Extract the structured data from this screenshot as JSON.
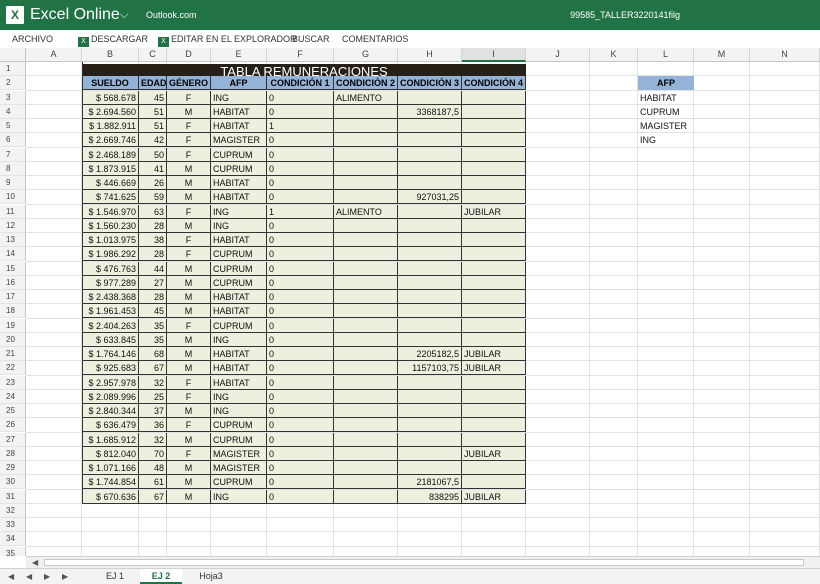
{
  "app": {
    "logo": "X",
    "name": "Excel Online",
    "service": "Outlook.com",
    "document_name": "99585_TALLER3220141filg"
  },
  "ribbon": {
    "archivo": "ARCHIVO",
    "descargar": "DESCARGAR",
    "editar": "EDITAR EN EL EXPLORADOR",
    "buscar": "BUSCAR",
    "comentarios": "COMENTARIOS"
  },
  "columns": [
    "A",
    "B",
    "C",
    "D",
    "E",
    "F",
    "G",
    "H",
    "I",
    "J",
    "K",
    "L",
    "M",
    "N"
  ],
  "selected_column": "I",
  "row_numbers": [
    "1",
    "2",
    "3",
    "4",
    "5",
    "6",
    "7",
    "8",
    "9",
    "10",
    "11",
    "12",
    "13",
    "14",
    "15",
    "16",
    "17",
    "18",
    "19",
    "20",
    "21",
    "22",
    "23",
    "24",
    "25",
    "26",
    "27",
    "28",
    "29",
    "30",
    "31",
    "32",
    "33",
    "34",
    "35"
  ],
  "table": {
    "title": "TABLA REMUNERACIONES",
    "headers": [
      "SUELDO",
      "EDAD",
      "GÉNERO",
      "AFP",
      "CONDICIÓN 1",
      "CONDICIÓN 2",
      "CONDICIÓN 3",
      "CONDICIÓN 4"
    ],
    "rows": [
      [
        "$ 568.678",
        "45",
        "F",
        "ING",
        "0",
        "ALIMENTO",
        "",
        ""
      ],
      [
        "$ 2.694.560",
        "51",
        "M",
        "HABITAT",
        "0",
        "",
        "3368187,5",
        ""
      ],
      [
        "$ 1.882.911",
        "51",
        "F",
        "HABITAT",
        "1",
        "",
        "",
        ""
      ],
      [
        "$ 2.669.746",
        "42",
        "F",
        "MAGISTER",
        "0",
        "",
        "",
        ""
      ],
      [
        "$ 2.468.189",
        "50",
        "F",
        "CUPRUM",
        "0",
        "",
        "",
        ""
      ],
      [
        "$ 1.873.915",
        "41",
        "M",
        "CUPRUM",
        "0",
        "",
        "",
        ""
      ],
      [
        "$ 446.669",
        "26",
        "M",
        "HABITAT",
        "0",
        "",
        "",
        ""
      ],
      [
        "$ 741.625",
        "59",
        "M",
        "HABITAT",
        "0",
        "",
        "927031,25",
        ""
      ],
      [
        "$ 1.546.970",
        "63",
        "F",
        "ING",
        "1",
        "ALIMENTO",
        "",
        "JUBILAR"
      ],
      [
        "$ 1.560.230",
        "28",
        "M",
        "ING",
        "0",
        "",
        "",
        ""
      ],
      [
        "$ 1.013.975",
        "38",
        "F",
        "HABITAT",
        "0",
        "",
        "",
        ""
      ],
      [
        "$ 1.986.292",
        "28",
        "F",
        "CUPRUM",
        "0",
        "",
        "",
        ""
      ],
      [
        "$ 476.763",
        "44",
        "M",
        "CUPRUM",
        "0",
        "",
        "",
        ""
      ],
      [
        "$ 977.289",
        "27",
        "M",
        "CUPRUM",
        "0",
        "",
        "",
        ""
      ],
      [
        "$ 2.438.368",
        "28",
        "M",
        "HABITAT",
        "0",
        "",
        "",
        ""
      ],
      [
        "$ 1.961.453",
        "45",
        "M",
        "HABITAT",
        "0",
        "",
        "",
        ""
      ],
      [
        "$ 2.404.263",
        "35",
        "F",
        "CUPRUM",
        "0",
        "",
        "",
        ""
      ],
      [
        "$ 633.845",
        "35",
        "M",
        "ING",
        "0",
        "",
        "",
        ""
      ],
      [
        "$ 1.764.146",
        "68",
        "M",
        "HABITAT",
        "0",
        "",
        "2205182,5",
        "JUBILAR"
      ],
      [
        "$ 925.683",
        "67",
        "M",
        "HABITAT",
        "0",
        "",
        "1157103,75",
        "JUBILAR"
      ],
      [
        "$ 2.957.978",
        "32",
        "F",
        "HABITAT",
        "0",
        "",
        "",
        ""
      ],
      [
        "$ 2.089.996",
        "25",
        "F",
        "ING",
        "0",
        "",
        "",
        ""
      ],
      [
        "$ 2.840.344",
        "37",
        "M",
        "ING",
        "0",
        "",
        "",
        ""
      ],
      [
        "$ 636.479",
        "36",
        "F",
        "CUPRUM",
        "0",
        "",
        "",
        ""
      ],
      [
        "$ 1.685.912",
        "32",
        "M",
        "CUPRUM",
        "0",
        "",
        "",
        ""
      ],
      [
        "$ 812.040",
        "70",
        "F",
        "MAGISTER",
        "0",
        "",
        "",
        "JUBILAR"
      ],
      [
        "$ 1.071.166",
        "48",
        "M",
        "MAGISTER",
        "0",
        "",
        "",
        ""
      ],
      [
        "$ 1.744.854",
        "61",
        "M",
        "CUPRUM",
        "0",
        "",
        "2181067,5",
        ""
      ],
      [
        "$ 670.636",
        "67",
        "M",
        "ING",
        "0",
        "",
        "838295",
        "JUBILAR"
      ]
    ]
  },
  "afp_list": {
    "header": "AFP",
    "items": [
      "HABITAT",
      "CUPRUM",
      "MAGISTER",
      "ING"
    ]
  },
  "sheets": [
    "EJ 1",
    "EJ 2",
    "Hoja3"
  ],
  "active_sheet": "EJ 2",
  "colors": {
    "excel_green": "#217346",
    "table_title_bg": "#262016",
    "header_blue": "#95b3d7",
    "cell_green": "#ebf1de"
  }
}
